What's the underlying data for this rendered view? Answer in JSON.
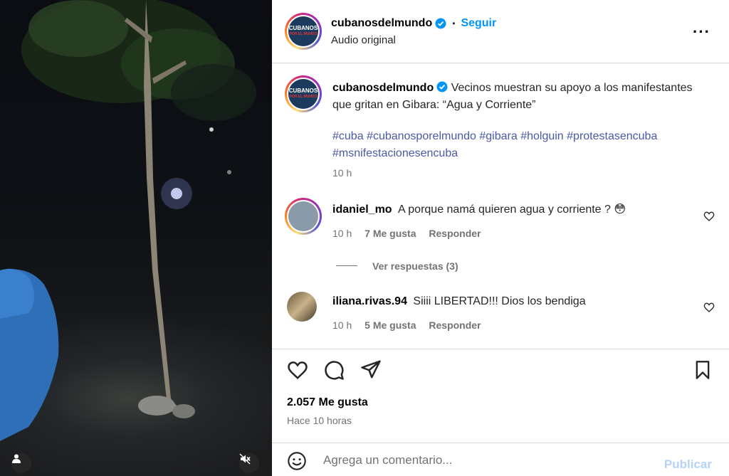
{
  "post": {
    "username": "cubanosdelmundo",
    "follow_label": "Seguir",
    "separator": "•",
    "audio_label": "Audio original",
    "avatar_text_1": "CUBANOS",
    "avatar_text_2": "POR EL MUNDO"
  },
  "caption": {
    "username": "cubanosdelmundo",
    "text": "Vecinos muestran su apoyo a los manifestantes que gritan en Gibara: “Agua y Corriente”",
    "hashtags": "#cuba #cubanosporelmundo #gibara #holguin #protestasencuba #msnifestacionesencuba",
    "time": "10 h"
  },
  "comments": [
    {
      "username": "idaniel_mo",
      "text": "A porque namá quieren agua y corriente ? 😳",
      "time": "10 h",
      "likes": "7 Me gusta",
      "reply_label": "Responder",
      "view_replies": "Ver respuestas (3)"
    },
    {
      "username": "iliana.rivas.94",
      "text": "Siiii LIBERTAD!!! Dios los bendiga",
      "time": "10 h",
      "likes": "5 Me gusta",
      "reply_label": "Responder"
    }
  ],
  "stats": {
    "likes": "2.057 Me gusta",
    "time_ago": "Hace 10 horas"
  },
  "composer": {
    "placeholder": "Agrega un comentario...",
    "publish_label": "Publicar"
  },
  "icons": {
    "more": "more-options-icon",
    "like": "heart-icon",
    "comment": "comment-icon",
    "share": "share-icon",
    "save": "bookmark-icon",
    "emoji": "emoji-icon",
    "user": "user-tag-icon",
    "mute": "muted-audio-icon"
  },
  "colors": {
    "accent": "#0095f6",
    "hashtag": "#4a5aa8",
    "verified": "#0095f6"
  }
}
